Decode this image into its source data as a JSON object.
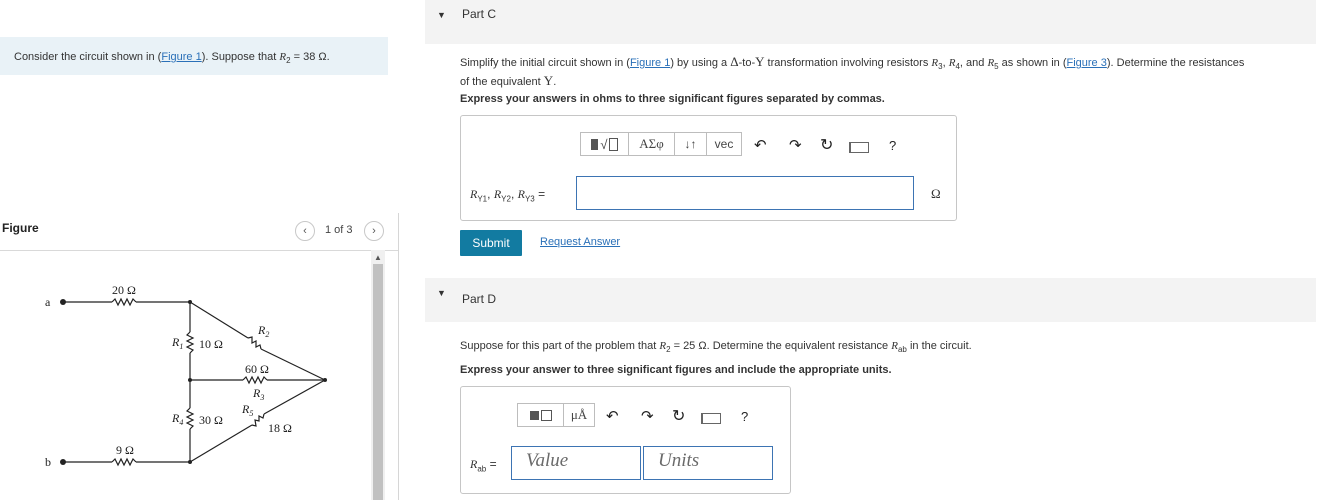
{
  "intro": {
    "pre": "Consider the circuit shown in (",
    "link": "Figure 1",
    "mid": "). Suppose that ",
    "var": "R",
    "sub": "2",
    "post": " = 38 Ω."
  },
  "figure": {
    "title": "Figure",
    "page": "1 of 3",
    "circuit": {
      "node_a": "a",
      "node_b": "b",
      "r_top": "20 Ω",
      "r_bottom": "9 Ω",
      "r1_name": "R",
      "r1_sub": "1",
      "r1_val": "10 Ω",
      "r2_name": "R",
      "r2_sub": "2",
      "r3_val": "60 Ω",
      "r3_name": "R",
      "r3_sub": "3",
      "r4_name": "R",
      "r4_sub": "4",
      "r4_val": "30 Ω",
      "r5_name": "R",
      "r5_sub": "5",
      "r5_val": "18 Ω"
    }
  },
  "part_c": {
    "label": "Part C",
    "q1": "Simplify the initial circuit shown in (",
    "q1_link": "Figure 1",
    "q2": ") by using a ",
    "q2_delta": "Δ",
    "q3": "-to-",
    "q3_y": "Y",
    "q4": " transformation involving resistors ",
    "r3": "R",
    "r3_sub": "3",
    "comma1": ", ",
    "r4": "R",
    "r4_sub": "4",
    "and": ", and ",
    "r5": "R",
    "r5_sub": "5",
    "q5": " as shown in (",
    "q5_link": "Figure 3",
    "q6": "). Determine the resistances",
    "line2a": "of the equivalent ",
    "line2_y": "Y",
    "line2b": ".",
    "instruction": "Express your answers in ohms to three significant figures separated by commas.",
    "toolbar": {
      "templates": "▯√▯",
      "greek": "ΑΣφ",
      "arrows": "↓↑",
      "vec": "vec",
      "help": "?"
    },
    "answer_label": "R",
    "answer_label_full": "RY1, RY2, RY3 =",
    "lbl_y1": "Y1",
    "lbl_y2": "Y2",
    "lbl_y3": "Y3",
    "unit": "Ω",
    "submit": "Submit",
    "request": "Request Answer"
  },
  "part_d": {
    "label": "Part D",
    "q1": "Suppose for this part of the problem that ",
    "r2": "R",
    "r2_sub": "2",
    "q2": " = 25 Ω. Determine the equivalent resistance ",
    "rab": "R",
    "rab_sub": "ab",
    "q3": " in the circuit.",
    "instruction": "Express your answer to three significant figures and include the appropriate units.",
    "toolbar": {
      "units": "μÅ",
      "help": "?"
    },
    "answer_label": "R",
    "answer_sub": "ab",
    "eq": " =",
    "value_placeholder": "Value",
    "units_placeholder": "Units"
  }
}
